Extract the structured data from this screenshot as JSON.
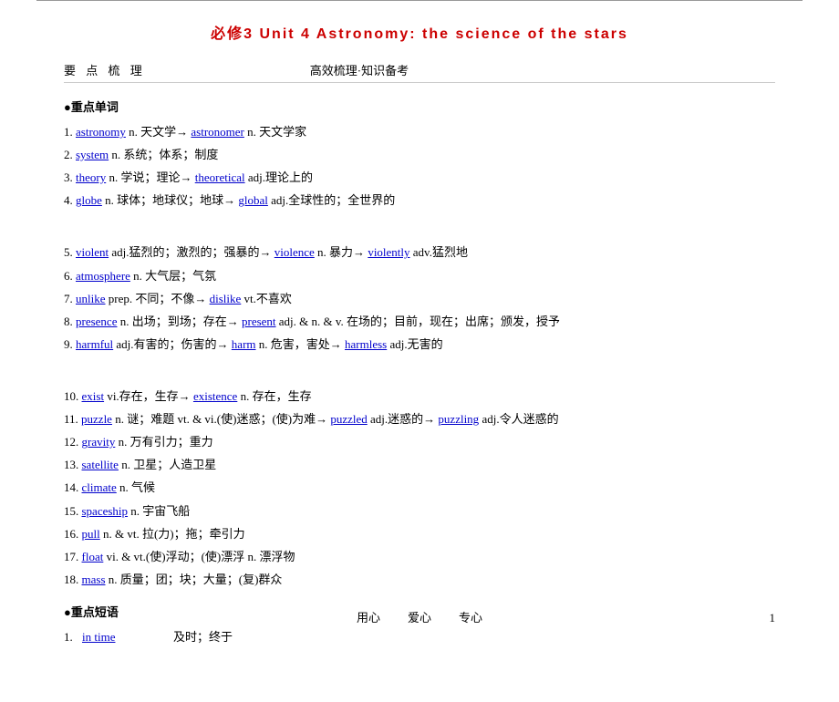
{
  "topBorder": true,
  "title": "必修3  Unit 4  Astronomy: the science of the stars",
  "sectionHeader": {
    "left": "要 点 梳 理",
    "right": "高效梳理·知识备考"
  },
  "keywordSectionTitle": "●重点单词",
  "words": [
    {
      "num": "1.",
      "word": "astronomy",
      "pos": "n. 天文学→",
      "derived": "astronomer",
      "derivedPos": " n. 天文学家"
    },
    {
      "num": "2.",
      "word": "system",
      "pos": "n. 系统；体系；制度",
      "derived": "",
      "derivedPos": ""
    },
    {
      "num": "3.",
      "word": "theory",
      "pos": "n. 学说；理论→",
      "derived": "theoretical",
      "derivedPos": " adj.理论上的"
    },
    {
      "num": "4.",
      "word": "globe",
      "pos": "n. 球体；地球仪；地球→",
      "derived": "global",
      "derivedPos": " adj.全球性的；全世界的"
    },
    {
      "num": "spacer",
      "word": "",
      "pos": "",
      "derived": "",
      "derivedPos": ""
    },
    {
      "num": "5.",
      "word": "violent",
      "pos": "adj.猛烈的；激烈的；强暴的→",
      "derived": "violence",
      "derivedPos": " n. 暴力→",
      "derived2": "violently",
      "derived2Pos": " adv.猛烈地"
    },
    {
      "num": "6.",
      "word": "atmosphere",
      "pos": "n. 大气层；气氛",
      "derived": "",
      "derivedPos": ""
    },
    {
      "num": "7.",
      "word": "unlike",
      "pos": "prep. 不同；不像→",
      "derived": "dislike",
      "derivedPos": " vt.不喜欢"
    },
    {
      "num": "8.",
      "word": "presence",
      "pos": "n. 出场；到场；存在→",
      "derived": "present",
      "derivedPos": " adj. & n. & v. 在场的；目前，现在；出席；颁发，授予"
    },
    {
      "num": "9.",
      "word": "harmful",
      "pos": "adj.有害的；伤害的→",
      "derived": "harm",
      "derivedPos": " n. 危害，害处→",
      "derived2": "harmless",
      "derived2Pos": " adj.无害的"
    },
    {
      "num": "spacer2",
      "word": "",
      "pos": "",
      "derived": "",
      "derivedPos": ""
    },
    {
      "num": "10.",
      "word": "exist",
      "pos": "vi.存在，生存→",
      "derived": "existence",
      "derivedPos": " n. 存在，生存"
    },
    {
      "num": "11.",
      "word": "puzzle",
      "pos": "n. 谜；难题 vt. & vi.(使)迷惑；(使)为难→",
      "derived": "puzzled",
      "derivedPos": " adj.迷惑的→",
      "derived2": "puzzling",
      "derived2Pos": " adj.令人迷惑的"
    },
    {
      "num": "12.",
      "word": "gravity",
      "pos": "n. 万有引力；重力",
      "derived": "",
      "derivedPos": ""
    },
    {
      "num": "13.",
      "word": "satellite",
      "pos": "n. 卫星；人造卫星",
      "derived": "",
      "derivedPos": ""
    },
    {
      "num": "14.",
      "word": "climate",
      "pos": "n. 气候",
      "derived": "",
      "derivedPos": ""
    },
    {
      "num": "15.",
      "word": "spaceship",
      "pos": "n. 宇宙飞船",
      "derived": "",
      "derivedPos": ""
    },
    {
      "num": "16.",
      "word": "pull",
      "pos": "n. & vt. 拉(力)；拖；牵引力",
      "derived": "",
      "derivedPos": ""
    },
    {
      "num": "17.",
      "word": "float",
      "pos": "vi. & vt.(使)浮动；(使)漂浮 n. 漂浮物",
      "derived": "",
      "derivedPos": ""
    },
    {
      "num": "18.",
      "word": "mass",
      "pos": "n. 质量；团；块；大量；(复)群众",
      "derived": "",
      "derivedPos": ""
    }
  ],
  "phraseSectionTitle": "●重点短语",
  "phrases": [
    {
      "num": "1.",
      "word": "in time",
      "meaning": "及时；终于"
    }
  ],
  "footer": {
    "left": "用心",
    "center": "爱心",
    "right": "专心",
    "page": "1"
  }
}
